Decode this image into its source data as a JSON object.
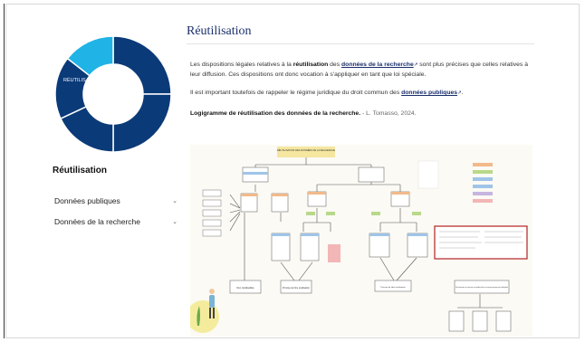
{
  "sidebar": {
    "donut_label": "RÉUTILISATION",
    "title": "Réutilisation",
    "items": [
      {
        "label": "Données publiques",
        "chevron": "chevron-down-icon"
      },
      {
        "label": "Données de la recherche",
        "chevron": "chevron-down-icon"
      }
    ],
    "donut_colors": {
      "highlight": "#1fb3e6",
      "dark": "#0b3a78",
      "separator": "#ffffff"
    }
  },
  "main": {
    "title": "Réutilisation",
    "p1": {
      "pre": "Les dispositions légales relatives à la ",
      "strong": "réutilisation",
      "mid": " des ",
      "link": "données de la recherche",
      "post": " sont plus précises que celles relatives à leur diffusion. Ces dispositions ont donc vocation à s'appliquer en tant que loi spéciale."
    },
    "p2": {
      "pre": "Il est important toutefois de rappeler le régime juridique du droit commun des ",
      "link": "données publiques",
      "post": "."
    },
    "caption": {
      "strong": "Logigramme de réutilisation des données de la recherche.",
      "author": " - L. Tomasso, 2024."
    },
    "external_icon": "external-link-icon"
  },
  "diagram": {
    "header": "RÉUTILISATION DES DONNÉES DE LA RECHERCHE",
    "bottom_labels": [
      "Non réutilisables",
      "Principe de libre réutilisation",
      "Principe de libre réutilisation",
      "Si les données ne sont pas accessibles elles ne sont pas principe pas réutilisables"
    ],
    "colors": {
      "bg": "#fbfaf4",
      "header": "#f5e6a0",
      "box": "#ffffff",
      "line": "#555555",
      "orange": "#f2b98a",
      "green": "#b8d98a",
      "blue": "#9fc4e8",
      "pink": "#f3b6b6",
      "red": "#b22222"
    }
  }
}
